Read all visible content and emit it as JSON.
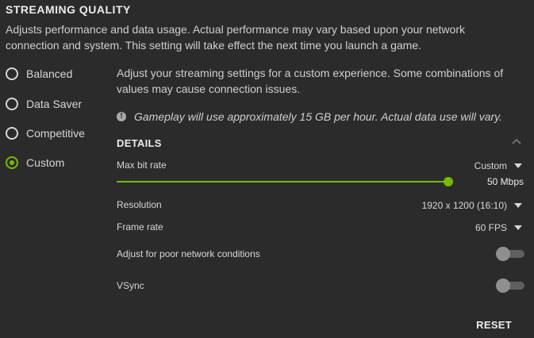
{
  "header": {
    "title": "STREAMING QUALITY",
    "description": "Adjusts performance and data usage. Actual performance may vary based upon your network connection and system. This setting will take effect the next time you launch a game."
  },
  "presets": {
    "selected": "Custom",
    "items": [
      {
        "label": "Balanced"
      },
      {
        "label": "Data Saver"
      },
      {
        "label": "Competitive"
      },
      {
        "label": "Custom"
      }
    ]
  },
  "custom_panel": {
    "note": "Adjust your streaming settings for a custom experience. Some combinations of values may cause connection issues.",
    "info_text": "Gameplay will use approximately 15 GB per hour. Actual data use will vary."
  },
  "details": {
    "heading": "DETAILS",
    "max_bit_rate": {
      "label": "Max bit rate",
      "mode": "Custom",
      "value_text": "50 Mbps",
      "slider_fraction": 1.0
    },
    "resolution": {
      "label": "Resolution",
      "value": "1920 x 1200 (16:10)"
    },
    "frame_rate": {
      "label": "Frame rate",
      "value": "60 FPS"
    },
    "poor_network": {
      "label": "Adjust for poor network conditions",
      "enabled": false
    },
    "vsync": {
      "label": "VSync",
      "enabled": false
    }
  },
  "actions": {
    "reset_label": "RESET"
  },
  "colors": {
    "accent": "#76b900",
    "background": "#2b2b2b"
  },
  "icons": {
    "info": "info-icon",
    "collapse": "chevron-up-icon",
    "dropdown": "caret-down-icon"
  }
}
